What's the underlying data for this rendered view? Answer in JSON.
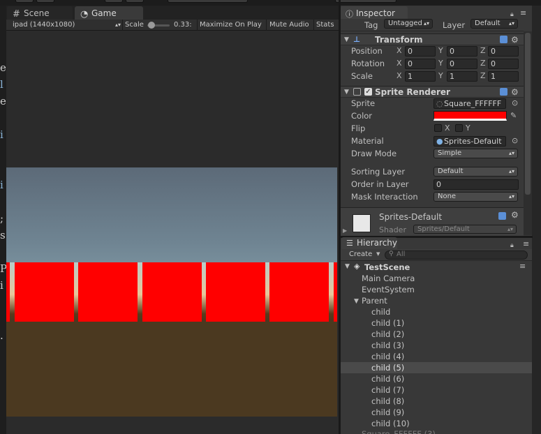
{
  "code_strip_chars": [
    "e",
    "l",
    "e",
    "i",
    "i",
    ";",
    "s",
    "P",
    "i",
    "."
  ],
  "game_view": {
    "tabs": [
      {
        "label": "Scene",
        "icon": "scene-grid-icon"
      },
      {
        "label": "Game",
        "icon": "game-pacman-icon"
      }
    ],
    "toolbar": {
      "resolution": "ipad (1440x1080)",
      "scale_label": "Scale",
      "scale_value": "0.33:",
      "maximize": "Maximize On Play",
      "mute": "Mute Audio",
      "stats": "Stats"
    },
    "sprite_color": "#ff0000",
    "sprite_count": 6
  },
  "inspector": {
    "tab_label": "Inspector",
    "tag_label": "Tag",
    "tag_value": "Untagged",
    "layer_label": "Layer",
    "layer_value": "Default",
    "transform": {
      "title": "Transform",
      "rows": [
        {
          "label": "Position",
          "x": "0",
          "y": "0",
          "z": "0"
        },
        {
          "label": "Rotation",
          "x": "0",
          "y": "0",
          "z": "0"
        },
        {
          "label": "Scale",
          "x": "1",
          "y": "1",
          "z": "1"
        }
      ],
      "axis_labels": [
        "X",
        "Y",
        "Z"
      ]
    },
    "sprite_renderer": {
      "title": "Sprite Renderer",
      "sprite_label": "Sprite",
      "sprite_value": "Square_FFFFFF",
      "color_label": "Color",
      "color_value": "#ff0000",
      "flip_label": "Flip",
      "flip_x": "X",
      "flip_y": "Y",
      "material_label": "Material",
      "material_value": "Sprites-Default",
      "draw_mode_label": "Draw Mode",
      "draw_mode_value": "Simple",
      "sorting_layer_label": "Sorting Layer",
      "sorting_layer_value": "Default",
      "order_label": "Order in Layer",
      "order_value": "0",
      "mask_label": "Mask Interaction",
      "mask_value": "None"
    },
    "material": {
      "name": "Sprites-Default",
      "shader_label": "Shader",
      "shader_value": "Sprites/Default"
    }
  },
  "hierarchy": {
    "tab_label": "Hierarchy",
    "create_label": "Create",
    "search_placeholder": "All",
    "scene_name": "TestScene",
    "items": [
      {
        "label": "Main Camera",
        "level": 1
      },
      {
        "label": "EventSystem",
        "level": 1
      },
      {
        "label": "Parent",
        "level": 1,
        "expanded": true
      },
      {
        "label": "child",
        "level": 2
      },
      {
        "label": "child (1)",
        "level": 2
      },
      {
        "label": "child (2)",
        "level": 2
      },
      {
        "label": "child (3)",
        "level": 2
      },
      {
        "label": "child (4)",
        "level": 2
      },
      {
        "label": "child (5)",
        "level": 2,
        "selected": true
      },
      {
        "label": "child (6)",
        "level": 2
      },
      {
        "label": "child (7)",
        "level": 2
      },
      {
        "label": "child (8)",
        "level": 2
      },
      {
        "label": "child (9)",
        "level": 2
      },
      {
        "label": "child (10)",
        "level": 2
      },
      {
        "label": "Square_FFFFFF (3)",
        "level": 1
      }
    ]
  }
}
